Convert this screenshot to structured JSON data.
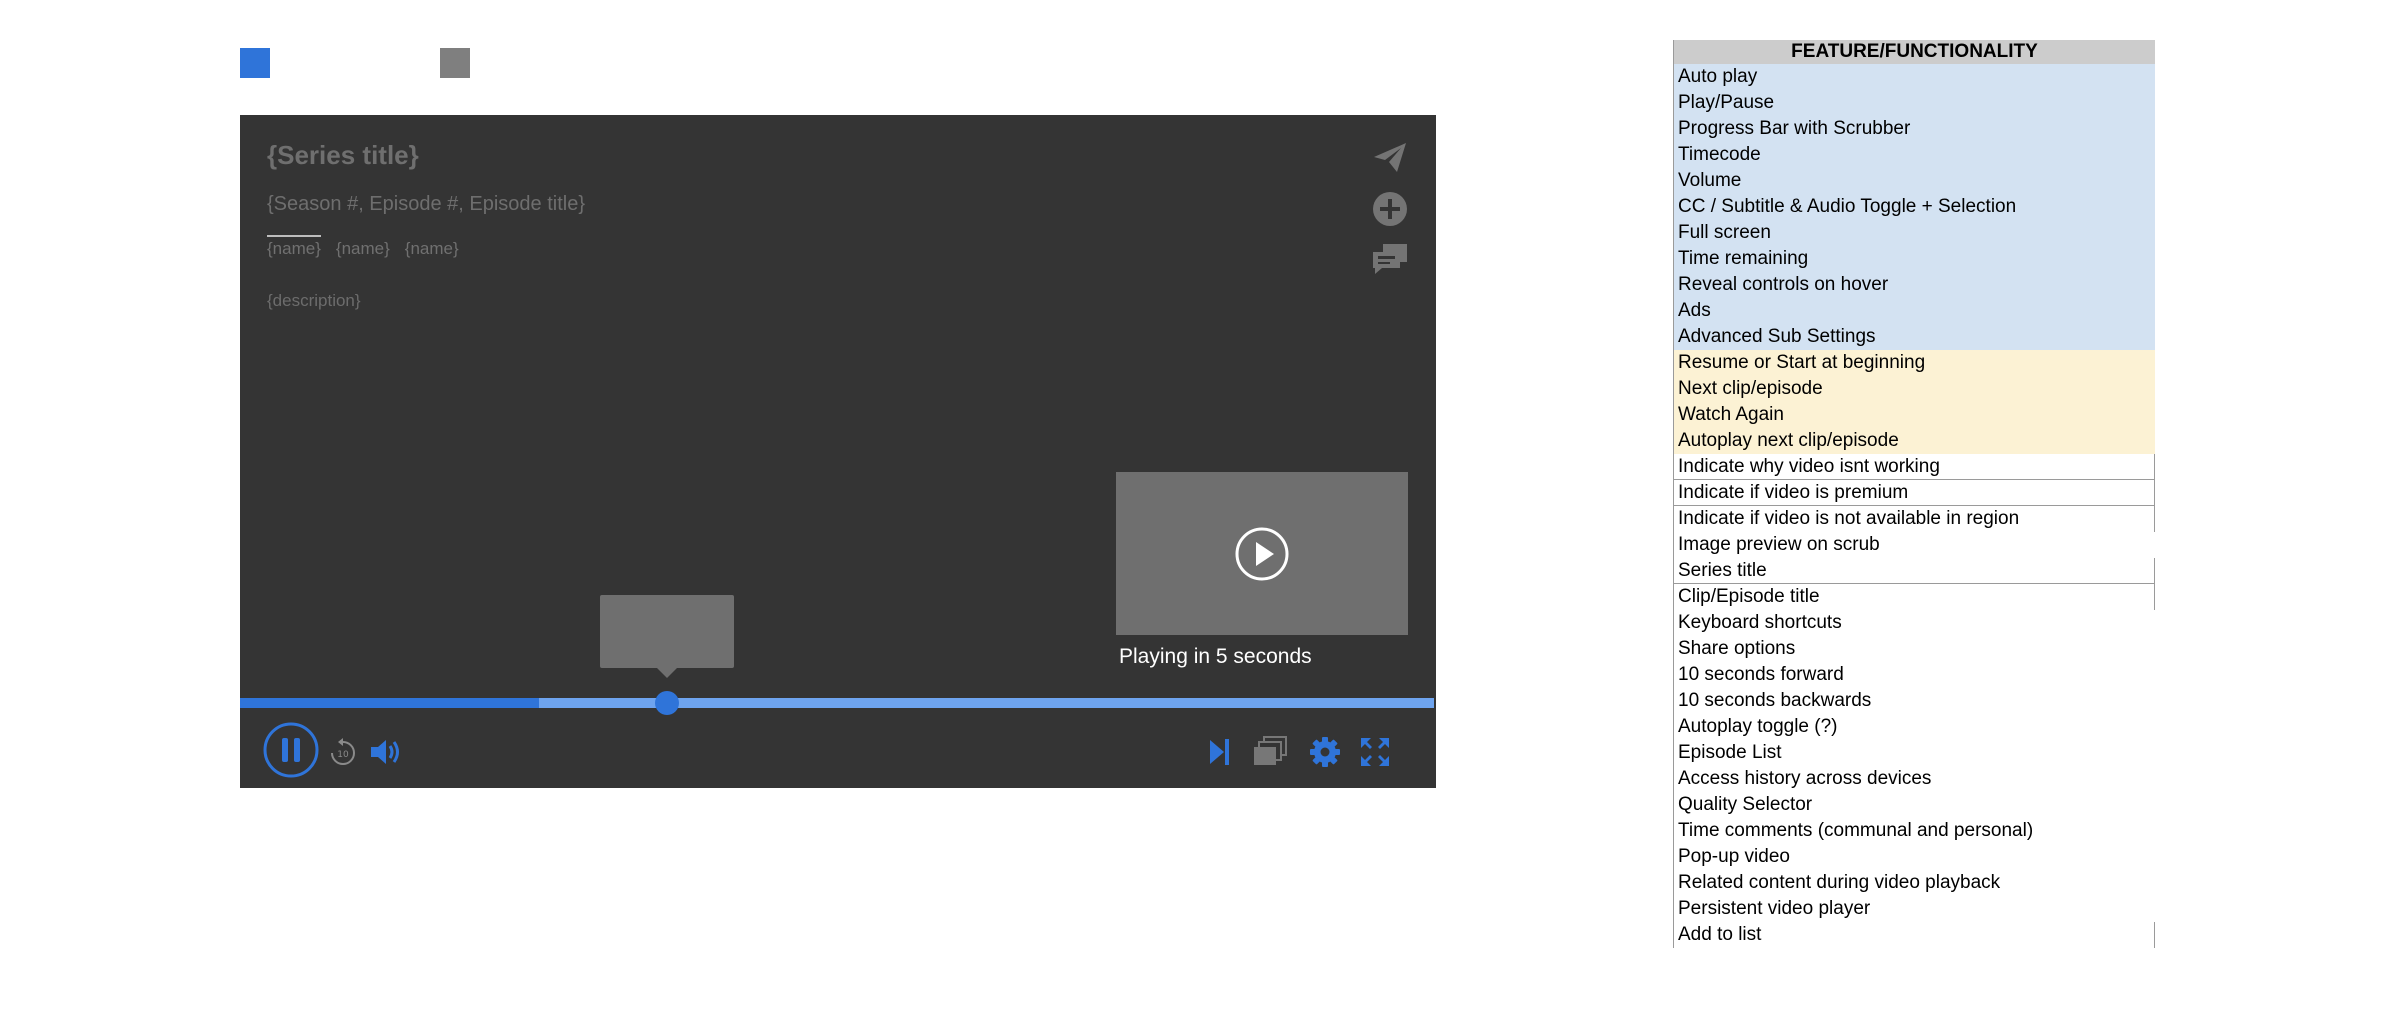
{
  "colors": {
    "accent_blue": "#2f74d9",
    "light_blue": "#6ea4ef",
    "player_bg": "#343434",
    "swatch_gray": "#7f7f7f",
    "row_blue": "#d3e2f2",
    "row_yellow": "#fcf2d4",
    "header_gray": "#cccccc"
  },
  "player": {
    "series_title": "{Series title}",
    "episode_title": "{Season #, Episode #, Episode title}",
    "name_tabs": [
      "{name}",
      "{name}",
      "{name}"
    ],
    "description": "{description}",
    "up_next_label": "Playing in 5 seconds",
    "progress_played": 0.25,
    "scrubber_position": 0.358,
    "icons": {
      "share": "share-icon",
      "add": "add-icon",
      "comments": "comments-icon",
      "pause": "pause-icon",
      "rewind": "rewind-10-icon",
      "volume": "volume-icon",
      "next": "next-episode-icon",
      "episodes": "episode-list-icon",
      "settings": "gear-icon",
      "fullscreen": "fullscreen-icon",
      "play": "play-icon"
    }
  },
  "feature_table": {
    "header": "FEATURE/FUNCTIONALITY",
    "rows": [
      {
        "label": "Auto play",
        "group": "blue"
      },
      {
        "label": "Play/Pause",
        "group": "blue"
      },
      {
        "label": "Progress Bar with Scrubber",
        "group": "blue"
      },
      {
        "label": "Timecode",
        "group": "blue"
      },
      {
        "label": "Volume",
        "group": "blue"
      },
      {
        "label": "CC / Subtitle & Audio Toggle + Selection",
        "group": "blue"
      },
      {
        "label": "Full screen",
        "group": "blue"
      },
      {
        "label": "Time remaining",
        "group": "blue"
      },
      {
        "label": "Reveal controls on hover",
        "group": "blue"
      },
      {
        "label": "Ads",
        "group": "blue"
      },
      {
        "label": "Advanced Sub Settings",
        "group": "blue"
      },
      {
        "label": "Resume or Start at beginning",
        "group": "yellow"
      },
      {
        "label": "Next clip/episode",
        "group": "yellow"
      },
      {
        "label": "Watch Again",
        "group": "yellow"
      },
      {
        "label": "Autoplay next clip/episode",
        "group": "yellow"
      },
      {
        "label": "Indicate why video isnt working",
        "group": "white"
      },
      {
        "label": "Indicate if video is premium",
        "group": "white"
      },
      {
        "label": "Indicate if video is not available in region",
        "group": "white"
      },
      {
        "label": "Image preview on scrub",
        "group": "white"
      },
      {
        "label": "Series title",
        "group": "white"
      },
      {
        "label": "Clip/Episode title",
        "group": "white"
      },
      {
        "label": "Keyboard shortcuts",
        "group": "white"
      },
      {
        "label": "Share options",
        "group": "white"
      },
      {
        "label": "10 seconds forward",
        "group": "white"
      },
      {
        "label": "10 seconds backwards",
        "group": "white"
      },
      {
        "label": "Autoplay toggle (?)",
        "group": "white"
      },
      {
        "label": "Episode List",
        "group": "white"
      },
      {
        "label": "Access history across devices",
        "group": "white"
      },
      {
        "label": "Quality Selector",
        "group": "white"
      },
      {
        "label": "Time comments (communal and personal)",
        "group": "white"
      },
      {
        "label": "Pop-up video",
        "group": "white"
      },
      {
        "label": "Related content during video playback",
        "group": "white"
      },
      {
        "label": "Persistent video player",
        "group": "white"
      },
      {
        "label": "Add to list",
        "group": "white"
      }
    ]
  }
}
